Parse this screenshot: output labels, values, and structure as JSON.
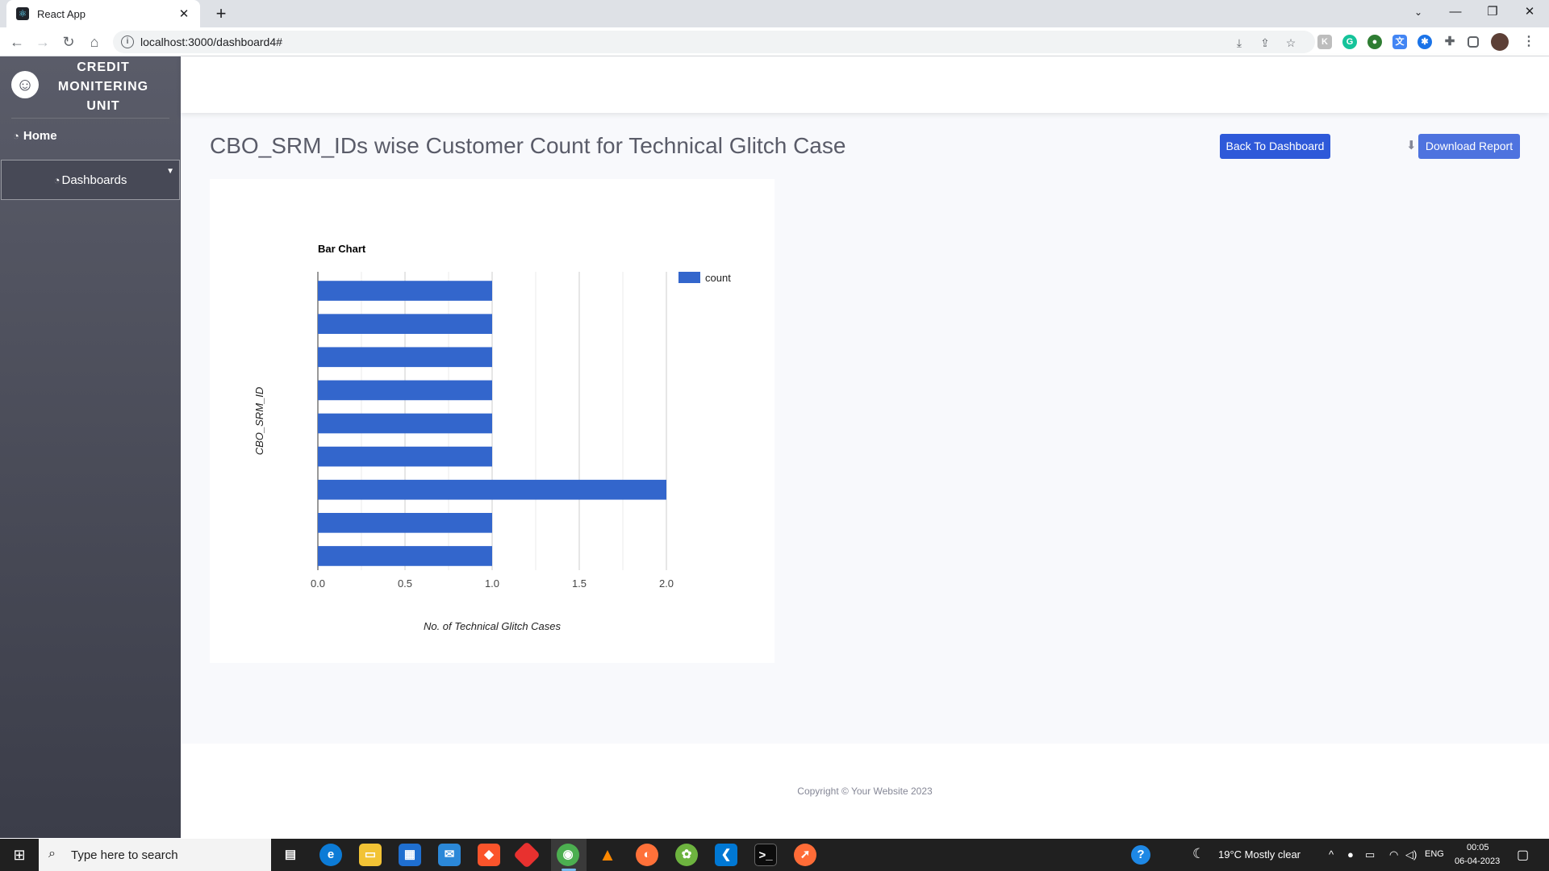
{
  "browser": {
    "tab_title": "React App",
    "url": "localhost:3000/dashboard4#"
  },
  "sidebar": {
    "brand_line1": "CREDIT",
    "brand_line2": "MONITERING",
    "brand_line3": "UNIT",
    "home_label": "Home",
    "dashboards_label": "Dashboards"
  },
  "main": {
    "title": "CBO_SRM_IDs wise Customer Count for Technical Glitch Case",
    "back_button": "Back To Dashboard",
    "download_button": "Download Report"
  },
  "footer": {
    "copyright": "Copyright © Your Website 2023"
  },
  "taskbar": {
    "search_placeholder": "Type here to search",
    "weather": "19°C  Mostly clear",
    "lang": "ENG",
    "time": "00:05",
    "date": "06-04-2023"
  },
  "colors": {
    "bar": "#3366cc",
    "primary_button": "#2e59d9",
    "download_button": "#4e73df"
  },
  "chart_data": {
    "type": "bar",
    "orientation": "horizontal",
    "title": "Bar Chart",
    "xlabel": "No. of Technical Glitch Cases",
    "ylabel": "CBO_SRM_ID",
    "xlim": [
      0,
      2
    ],
    "xticks": [
      "0.0",
      "0.5",
      "1.0",
      "1.5",
      "2.0"
    ],
    "categories": [
      "",
      "",
      "",
      "",
      "",
      "",
      "",
      "",
      ""
    ],
    "series": [
      {
        "name": "count",
        "values": [
          1,
          1,
          1,
          1,
          1,
          1,
          2,
          1,
          1
        ]
      }
    ],
    "legend_position": "top-right",
    "grid": true
  }
}
